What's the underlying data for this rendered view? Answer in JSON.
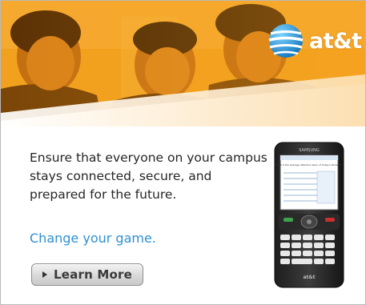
{
  "brand": {
    "name": "at&t",
    "colors": {
      "banner": "#f39c1c",
      "link_blue": "#2e90d1",
      "text_dark": "#262626"
    },
    "logo_icon": "att-globe-icon"
  },
  "copy": {
    "headline": "Ensure that everyone on your campus stays connected, secure, and prepared for the future.",
    "tagline": "Change your game."
  },
  "cta": {
    "label": "Learn More",
    "icon": "play-arrow-icon"
  },
  "phone": {
    "maker": "SAMSUNG",
    "carrier": "at&t",
    "screen_title": "What is the average attention span of today's students?"
  }
}
